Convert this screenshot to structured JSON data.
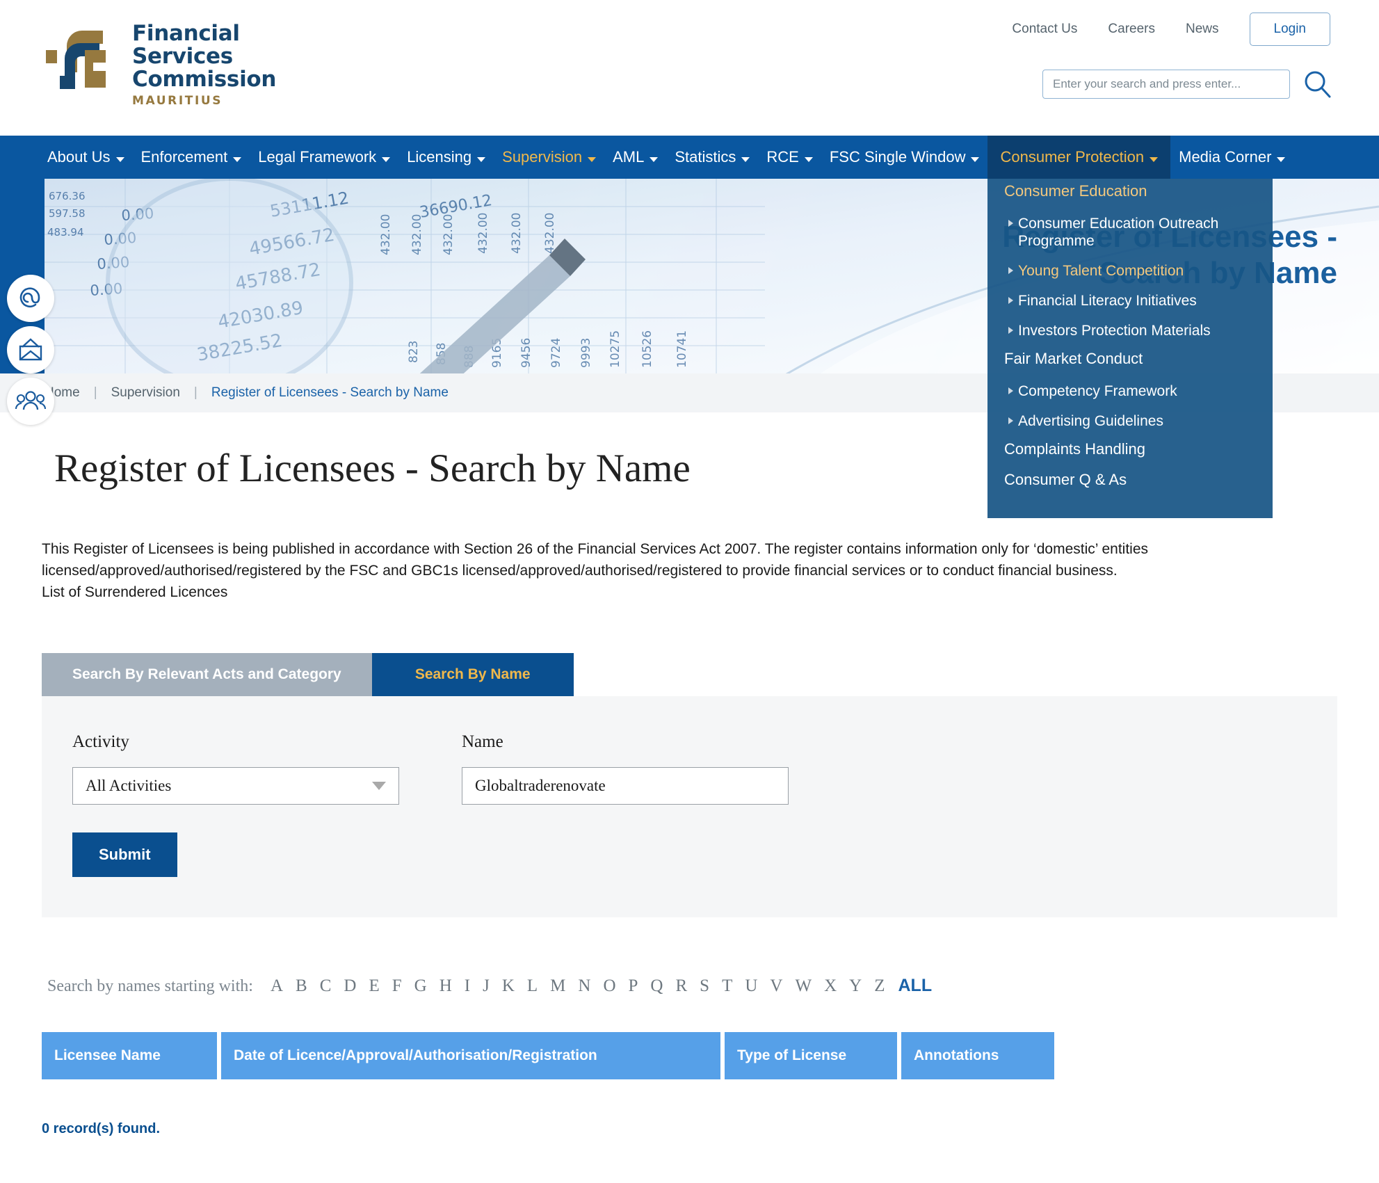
{
  "header": {
    "logo": {
      "line1": "Financial",
      "line2": "Services",
      "line3": "Commission",
      "subtitle": "MAURITIUS"
    },
    "util_links": [
      "Contact Us",
      "Careers",
      "News"
    ],
    "login_label": "Login",
    "search_placeholder": "Enter your search and press enter...",
    "search_value": ""
  },
  "nav": {
    "items": [
      {
        "label": "About Us",
        "state": "default"
      },
      {
        "label": "Enforcement",
        "state": "default"
      },
      {
        "label": "Legal Framework",
        "state": "default"
      },
      {
        "label": "Licensing",
        "state": "default"
      },
      {
        "label": "Supervision",
        "state": "highlight"
      },
      {
        "label": "AML",
        "state": "default"
      },
      {
        "label": "Statistics",
        "state": "default"
      },
      {
        "label": "RCE",
        "state": "default"
      },
      {
        "label": "FSC Single Window",
        "state": "default"
      },
      {
        "label": "Consumer Protection",
        "state": "open"
      },
      {
        "label": "Media Corner",
        "state": "default"
      }
    ]
  },
  "dropdown": {
    "entries": [
      {
        "label": "Consumer Education",
        "level": "head",
        "color": "gold"
      },
      {
        "label": "Consumer Education Outreach Programme",
        "level": "sub",
        "color": "white"
      },
      {
        "label": "Young Talent Competition",
        "level": "sub",
        "color": "gold"
      },
      {
        "label": "Financial Literacy Initiatives",
        "level": "sub",
        "color": "white"
      },
      {
        "label": "Investors Protection Materials",
        "level": "sub",
        "color": "white"
      },
      {
        "label": "Fair Market Conduct",
        "level": "head",
        "color": "white"
      },
      {
        "label": "Competency Framework",
        "level": "sub",
        "color": "white"
      },
      {
        "label": "Advertising Guidelines",
        "level": "sub",
        "color": "white"
      },
      {
        "label": "Complaints Handling",
        "level": "head",
        "color": "white"
      },
      {
        "label": "Consumer Q & As",
        "level": "head",
        "color": "white"
      }
    ]
  },
  "hero": {
    "title": "Register of Licensees - Search by Name"
  },
  "social_rail": [
    {
      "name": "at-icon"
    },
    {
      "name": "envelope-icon"
    },
    {
      "name": "people-icon"
    }
  ],
  "breadcrumb": {
    "home": "Home",
    "section": "Supervision",
    "current": "Register of Licensees - Search by Name",
    "separator": "|"
  },
  "page": {
    "title": "Register of Licensees - Search by Name",
    "intro_line1": "This Register of Licensees is being published in accordance with Section 26 of the Financial Services Act 2007. The register contains information only for ‘domestic’ entities",
    "intro_line2": "licensed/approved/authorised/registered by the FSC and GBC1s licensed/approved/authorised/registered to provide financial services or to conduct financial business.",
    "intro_line3": "List of Surrendered Licences"
  },
  "tabs": [
    {
      "label": "Search By Relevant Acts and Category",
      "active": false
    },
    {
      "label": "Search By Name",
      "active": true
    }
  ],
  "form": {
    "activity_label": "Activity",
    "activity_value": "All Activities",
    "name_label": "Name",
    "name_value": "Globaltraderenovate",
    "name_placeholder": "",
    "submit_label": "Submit"
  },
  "alphabet": {
    "label": "Search by names starting with:",
    "letters": [
      "A",
      "B",
      "C",
      "D",
      "E",
      "F",
      "G",
      "H",
      "I",
      "J",
      "K",
      "L",
      "M",
      "N",
      "O",
      "P",
      "Q",
      "R",
      "S",
      "T",
      "U",
      "V",
      "W",
      "X",
      "Y",
      "Z"
    ],
    "all_label": "ALL"
  },
  "results": {
    "columns": [
      "Licensee Name",
      "Date of Licence/Approval/Authorisation/Registration",
      "Type of License",
      "Annotations"
    ],
    "rows": [],
    "count_text": "0 record(s) found."
  },
  "colors": {
    "brand_blue": "#0a57a0",
    "dark_blue": "#0c3f6f",
    "gold": "#f0b84b",
    "logo_navy": "#17466e",
    "logo_gold": "#96793f",
    "table_header": "#56a0e8",
    "tab_inactive": "#a4b0bc"
  }
}
